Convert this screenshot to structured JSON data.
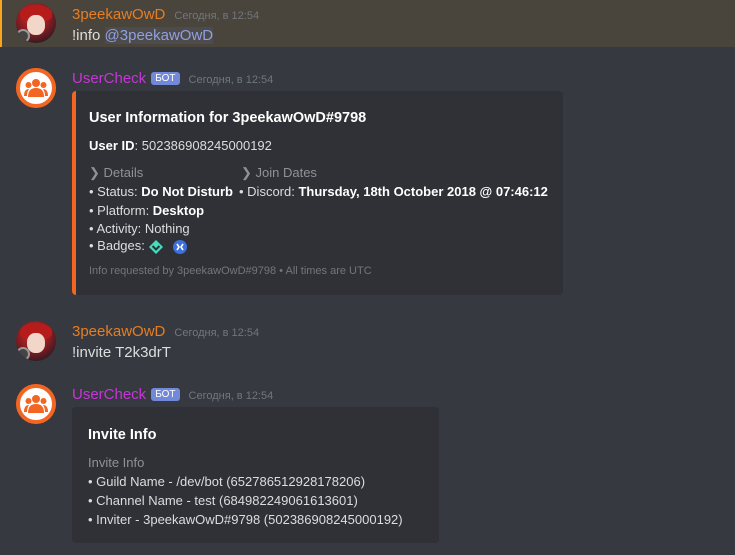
{
  "messages": {
    "m1": {
      "username": "3peekawOwD",
      "username_color": "#e67e22",
      "timestamp": "Сегодня, в 12:54",
      "text": "!info ",
      "mention": "@3peekawOwD"
    },
    "m2": {
      "username": "UserCheck",
      "username_color": "#c735d6",
      "bot_tag": "БОТ",
      "timestamp": "Сегодня, в 12:54",
      "embed": {
        "title": "User Information for 3peekawOwD#9798",
        "user_id_label": "User ID",
        "user_id_value": ": 502386908245000192",
        "details_header": "❯ Details",
        "join_header": "❯ Join Dates",
        "status_label": "• Status: ",
        "status_value": "Do Not Disturb",
        "discord_label": "• Discord: ",
        "discord_value": "Thursday, 18th October 2018 @ 07:46:12",
        "platform_label": "• Platform: ",
        "platform_value": "Desktop",
        "activity": "• Activity: Nothing",
        "badges_label": "• Badges: ",
        "badges": [
          "hypesquad-balance-badge-icon",
          "early-supporter-badge-icon"
        ],
        "footer": "Info requested by 3peekawOwD#9798 • All times are UTC"
      }
    },
    "m3": {
      "username": "3peekawOwD",
      "timestamp": "Сегодня, в 12:54",
      "text": "!invite T2k3drT"
    },
    "m4": {
      "username": "UserCheck",
      "bot_tag": "БОТ",
      "timestamp": "Сегодня, в 12:54",
      "embed": {
        "title": "Invite Info",
        "subtitle": "Invite Info",
        "lines": [
          "• Guild Name - /dev/bot (652786512928178206)",
          "• Channel Name - test (684982249061613601)",
          "• Inviter - 3peekawOwD#9798 (502386908245000192)"
        ]
      }
    }
  },
  "colors": {
    "user_name": "#e67e22",
    "bot_name": "#c735d6",
    "accent": "#f26522",
    "mention_bg": "#49443c",
    "mention_border": "#faa61a"
  }
}
